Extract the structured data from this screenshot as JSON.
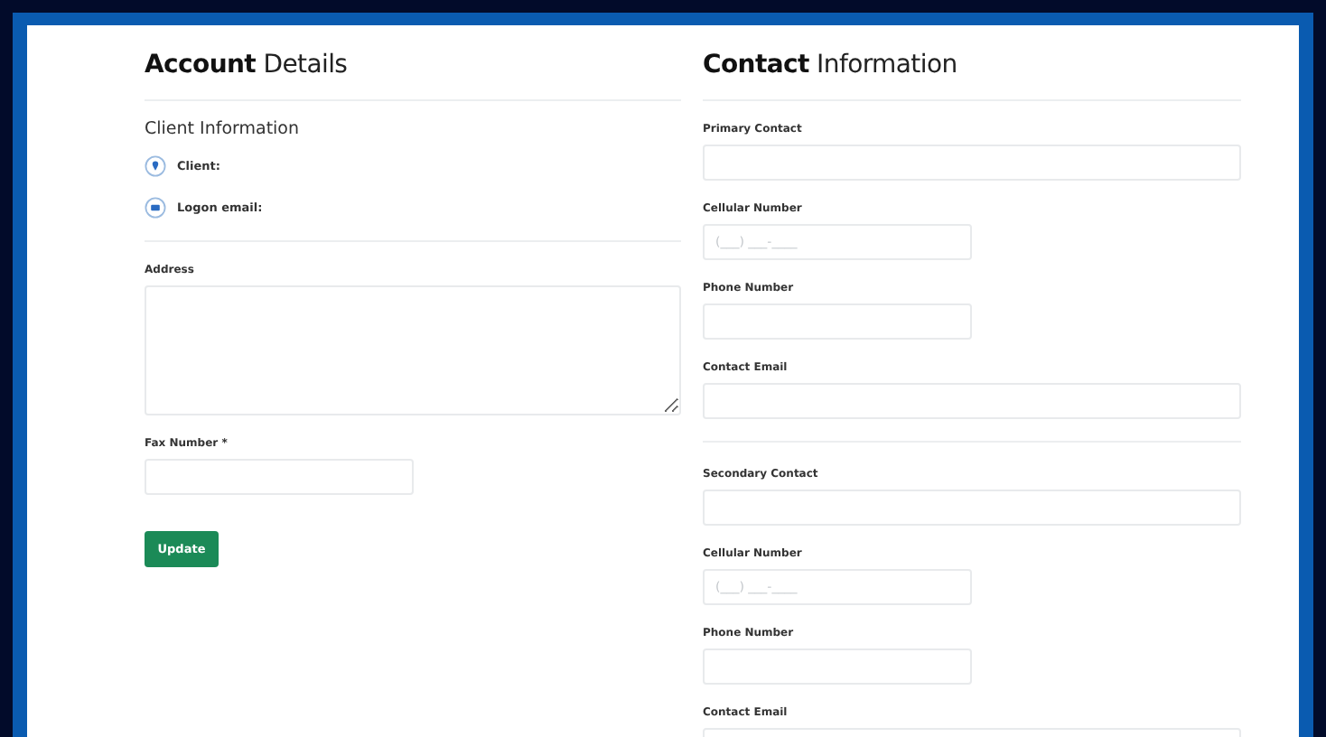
{
  "account": {
    "heading": "**Account** Details",
    "subheading": "Client Information",
    "info_rows": [
      {
        "kind": "pin",
        "label": "Client:"
      },
      {
        "kind": "mail",
        "label": "Logon email:"
      }
    ],
    "address": {
      "label": "Address"
    },
    "fax": {
      "label": "Fax Number *"
    },
    "update_button": "Update"
  },
  "contact": {
    "heading": "**Contact** Information",
    "groups": [
      {
        "fields": [
          {
            "label": "Primary Contact",
            "kind": "wide"
          },
          {
            "label": "Cellular Number",
            "kind": "narrow",
            "placeholder": "(___) ___-____"
          },
          {
            "label": "Phone Number",
            "kind": "narrow"
          },
          {
            "label": "Contact Email",
            "kind": "wide"
          }
        ]
      },
      {
        "fields": [
          {
            "label": "Secondary Contact",
            "kind": "wide"
          },
          {
            "label": "Cellular Number",
            "kind": "narrow",
            "placeholder": "(___) ___-____"
          },
          {
            "label": "Phone Number",
            "kind": "narrow"
          },
          {
            "label": "Contact Email",
            "kind": "wide"
          }
        ]
      }
    ]
  }
}
